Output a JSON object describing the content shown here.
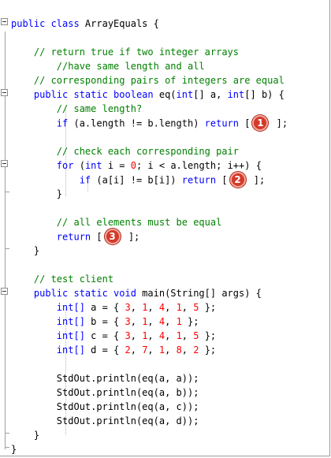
{
  "code": {
    "class_kw": "public class",
    "class_name": " ArrayEquals {",
    "c1": "// return true if two integer arrays",
    "c2": "//have same length and all",
    "c3": "// corresponding pairs of integers are equal",
    "eq_kw1": "public static boolean",
    "eq_rest1": " eq(",
    "eq_kw2": "int",
    "eq_rest2": "[] a, ",
    "eq_kw3": "int",
    "eq_rest3": "[] b) {",
    "c4": "// same length?",
    "if1_kw": "if",
    "if1_rest": " (a.length != b.length) ",
    "return_kw": "return",
    "open_bracket": " [",
    "close_semi": " ];",
    "badge1": "1",
    "c5": "// check each corresponding pair",
    "for_kw": "for",
    "for_p1": " (",
    "for_int": "int",
    "for_p2": " i = ",
    "for_zero": "0",
    "for_p3": "; i < a.length; i++) {",
    "if2_kw": "if",
    "if2_rest": " (a[i] != b[i]) ",
    "badge2": "2",
    "close_brace": "}",
    "c6": "// all elements must be equal",
    "badge3": "3",
    "c7": "// test client",
    "main_kw": "public static void",
    "main_rest": " main(String[] args) {",
    "arrays": [
      {
        "type": "int[]",
        "decl": " a = { ",
        "values": [
          "3",
          "1",
          "4",
          "1",
          "5"
        ]
      },
      {
        "type": "int[]",
        "decl": " b = { ",
        "values": [
          "3",
          "1",
          "4",
          "1"
        ]
      },
      {
        "type": "int[]",
        "decl": " c = { ",
        "values": [
          "3",
          "1",
          "4",
          "1",
          "5"
        ]
      },
      {
        "type": "int[]",
        "decl": " d = { ",
        "values": [
          "2",
          "7",
          "1",
          "8",
          "2"
        ]
      }
    ],
    "println": [
      "StdOut.println(eq(a, a));",
      "StdOut.println(eq(a, b));",
      "StdOut.println(eq(a, c));",
      "StdOut.println(eq(a, d));"
    ]
  },
  "colors": {
    "keyword": "#0000ff",
    "comment": "#008000",
    "number": "#ff0000",
    "badge": "#d23a2a"
  }
}
